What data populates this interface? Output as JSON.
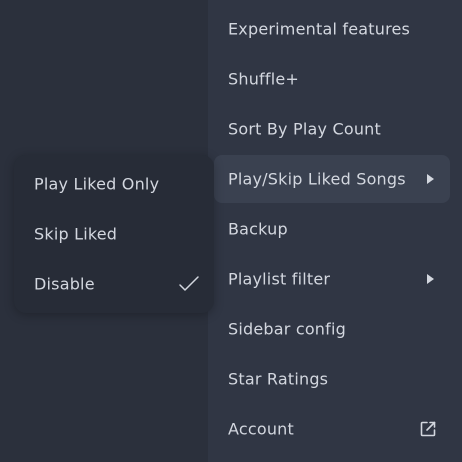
{
  "menu": {
    "items": [
      {
        "label": "Experimental features"
      },
      {
        "label": "Shuffle+"
      },
      {
        "label": "Sort By Play Count"
      },
      {
        "label": "Play/Skip Liked Songs",
        "submenu": true,
        "active": true,
        "icon": "chevron-right-icon"
      },
      {
        "label": "Backup"
      },
      {
        "label": "Playlist filter",
        "submenu": true,
        "icon": "chevron-right-icon"
      },
      {
        "label": "Sidebar config"
      },
      {
        "label": "Star Ratings"
      },
      {
        "label": "Account",
        "icon": "external-link-icon"
      }
    ]
  },
  "submenu": {
    "items": [
      {
        "label": "Play Liked Only",
        "checked": false
      },
      {
        "label": "Skip Liked",
        "checked": false
      },
      {
        "label": "Disable",
        "checked": true,
        "icon": "check-icon"
      }
    ]
  },
  "colors": {
    "background": "#2b303c",
    "menu_bg": "#303644",
    "active_item_bg": "#3a4150",
    "submenu_bg": "#272c37",
    "text": "#d3d7df"
  }
}
